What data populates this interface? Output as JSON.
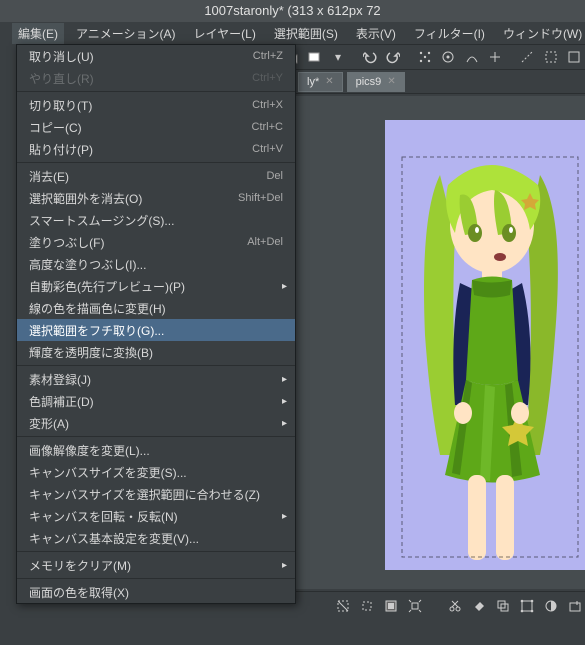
{
  "title": "1007staronly* (313 x 612px 72",
  "menubar": {
    "edit": "編集(E)",
    "animation": "アニメーション(A)",
    "layer": "レイヤー(L)",
    "select": "選択範囲(S)",
    "view": "表示(V)",
    "filter": "フィルター(I)",
    "window": "ウィンドウ(W)"
  },
  "tabs": {
    "t1_label": "ly*",
    "t2_label": "pics9"
  },
  "menu": {
    "undo": "取り消し(U)",
    "undo_sc": "Ctrl+Z",
    "redo": "やり直し(R)",
    "redo_sc": "Ctrl+Y",
    "cut": "切り取り(T)",
    "cut_sc": "Ctrl+X",
    "copy": "コピー(C)",
    "copy_sc": "Ctrl+C",
    "paste": "貼り付け(P)",
    "paste_sc": "Ctrl+V",
    "clear": "消去(E)",
    "clear_sc": "Del",
    "clear_outside": "選択範囲外を消去(O)",
    "clear_outside_sc": "Shift+Del",
    "smart_smoothing": "スマートスムージング(S)...",
    "fill": "塗りつぶし(F)",
    "fill_sc": "Alt+Del",
    "adv_fill": "高度な塗りつぶし(I)...",
    "auto_color": "自動彩色(先行プレビュー)(P)",
    "line_to_draw": "線の色を描画色に変更(H)",
    "outline_sel": "選択範囲をフチ取り(G)...",
    "lum_to_alpha": "輝度を透明度に変換(B)",
    "mat_reg": "素材登録(J)",
    "tone_corr": "色調補正(D)",
    "transform": "変形(A)",
    "change_res": "画像解像度を変更(L)...",
    "change_canvas": "キャンバスサイズを変更(S)...",
    "fit_canvas_sel": "キャンバスサイズを選択範囲に合わせる(Z)",
    "rotate_flip": "キャンバスを回転・反転(N)",
    "canvas_basic": "キャンバス基本設定を変更(V)...",
    "clear_mem": "メモリをクリア(M)",
    "screen_color": "画面の色を取得(X)"
  }
}
